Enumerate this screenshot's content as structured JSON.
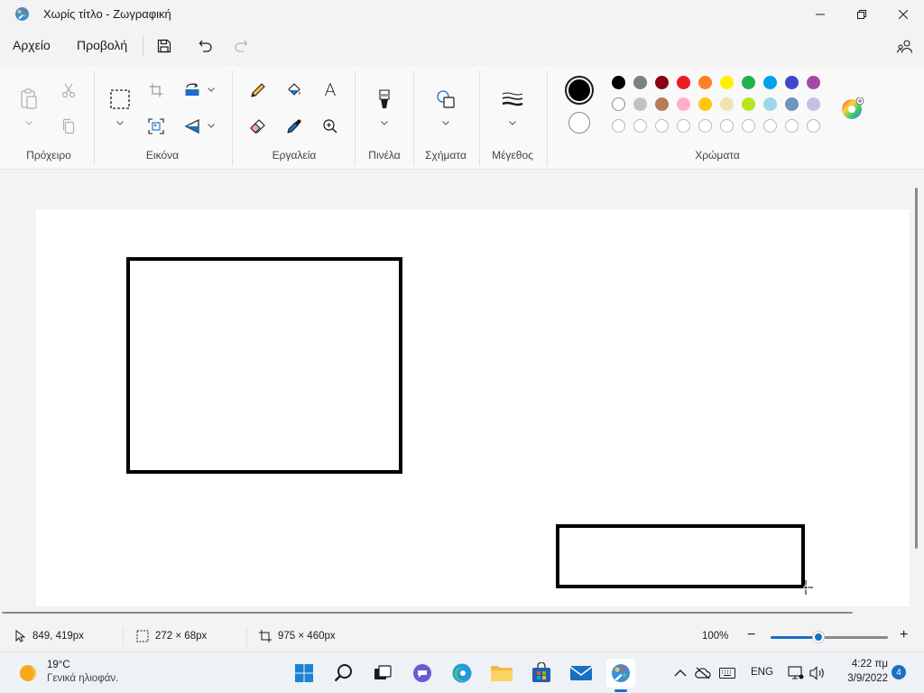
{
  "window": {
    "title": "Χωρίς τίτλο - Ζωγραφική"
  },
  "menu": {
    "file": "Αρχείο",
    "view": "Προβολή"
  },
  "ribbon": {
    "groups": {
      "clipboard": "Πρόχειρο",
      "image": "Εικόνα",
      "tools": "Εργαλεία",
      "brushes": "Πινέλα",
      "shapes": "Σχήματα",
      "size": "Μέγεθος",
      "colors": "Χρώματα"
    },
    "text_tool_glyph": "A"
  },
  "colors": {
    "primary": "#000000",
    "secondary": "#ffffff",
    "palette_row1": [
      "#000000",
      "#7f7f7f",
      "#880015",
      "#ed1c24",
      "#ff7f27",
      "#fff200",
      "#22b14c",
      "#00a2e8",
      "#3f48cc",
      "#a349a4"
    ],
    "palette_row2": [
      "#ffffff",
      "#c3c3c3",
      "#b97a57",
      "#ffaec9",
      "#ffc90e",
      "#efe4b0",
      "#b5e61d",
      "#99d9ea",
      "#7092be",
      "#c8bfe7"
    ],
    "palette_row3_empty_count_label": ""
  },
  "status": {
    "cursor_position": "849, 419px",
    "selection_size": "272 × 68px",
    "canvas_size": "975 × 460px",
    "zoom": "100%",
    "zoom_minus": "−",
    "zoom_plus": "+",
    "zoom_level_fraction": 0.4
  },
  "taskbar": {
    "weather_temp": "19°C",
    "weather_desc": "Γενικά ηλιοφάν.",
    "language": "ENG",
    "time": "4:22 πμ",
    "date": "3/9/2022",
    "notification_count": "4"
  }
}
